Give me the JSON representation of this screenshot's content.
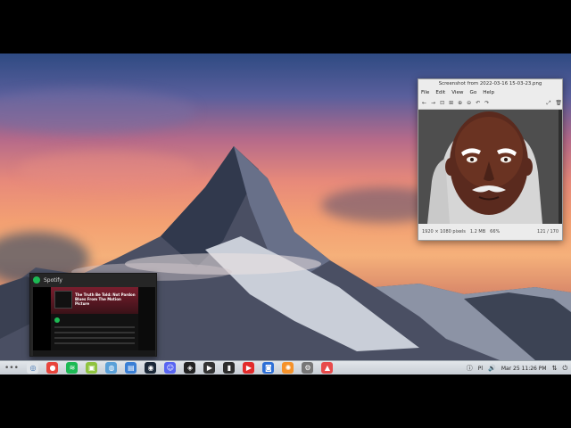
{
  "desktop": {
    "wallpaper": "mountain-sunset"
  },
  "viewer": {
    "title": "Screenshot from 2022-03-16 15-03-23.png",
    "menu": [
      "File",
      "Edit",
      "View",
      "Go",
      "Help"
    ],
    "status": {
      "dimensions": "1920 × 1080 pixels",
      "size": "1.2 MB",
      "zoom": "66%",
      "position": "121 / 170"
    }
  },
  "spotify": {
    "window_title": "Spotify",
    "album_title": "The Truth Be Told: Not Pardon Blues From The Motion Picture"
  },
  "taskbar": {
    "clock": "Mar 25  11:26 PM",
    "keyboard_layout": "Pl",
    "apps": [
      {
        "name": "menu-icon",
        "color": "#e0e4e8"
      },
      {
        "name": "chrome-icon",
        "color": "#e8453c"
      },
      {
        "name": "spotify-icon",
        "color": "#1db954"
      },
      {
        "name": "files-icon",
        "color": "#8fc33f"
      },
      {
        "name": "globe-icon",
        "color": "#5aa0d8"
      },
      {
        "name": "document-icon",
        "color": "#3a7fd5"
      },
      {
        "name": "steam-icon",
        "color": "#1b2838"
      },
      {
        "name": "discord-icon",
        "color": "#5865f2"
      },
      {
        "name": "unity-icon",
        "color": "#222222"
      },
      {
        "name": "video-editor-icon",
        "color": "#333333"
      },
      {
        "name": "terminal-icon",
        "color": "#2d2d2d"
      },
      {
        "name": "youtube-icon",
        "color": "#e22b2b"
      },
      {
        "name": "camera-icon",
        "color": "#2d6fd6"
      },
      {
        "name": "blender-icon",
        "color": "#f5922a"
      },
      {
        "name": "settings-icon",
        "color": "#777777"
      },
      {
        "name": "photos-icon",
        "color": "#e84b4b"
      }
    ]
  }
}
